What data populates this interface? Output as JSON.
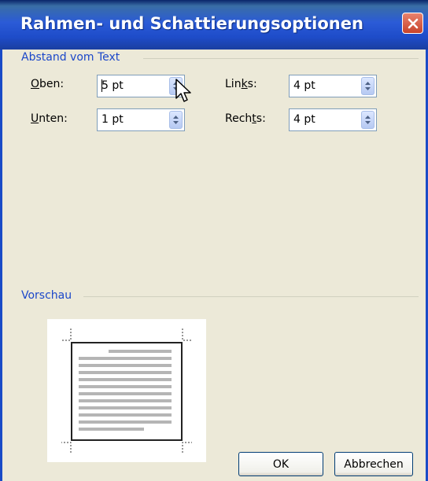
{
  "dialog": {
    "title": "Rahmen- und Schattierungsoptionen"
  },
  "distance_group": {
    "label": "Abstand vom Text",
    "top": {
      "label_pre": "",
      "label_key": "O",
      "label_post": "ben:",
      "value": "5 pt"
    },
    "bottom": {
      "label_pre": "",
      "label_key": "U",
      "label_post": "nten:",
      "value": "1 pt"
    },
    "left": {
      "label_pre": "Lin",
      "label_key": "k",
      "label_post": "s:",
      "value": "4 pt"
    },
    "right": {
      "label_pre": "Rech",
      "label_key": "t",
      "label_post": "s:",
      "value": "4 pt"
    }
  },
  "preview_group": {
    "label": "Vorschau"
  },
  "buttons": {
    "ok": "OK",
    "cancel": "Abbrechen"
  },
  "icons": {
    "close": "close-icon",
    "spin": "spin-arrows-icon",
    "cursor": "mouse-pointer-icon"
  },
  "colors": {
    "title_bar": "#2B5BD7",
    "group_label": "#1B47C9",
    "background": "#ECE9D8"
  }
}
